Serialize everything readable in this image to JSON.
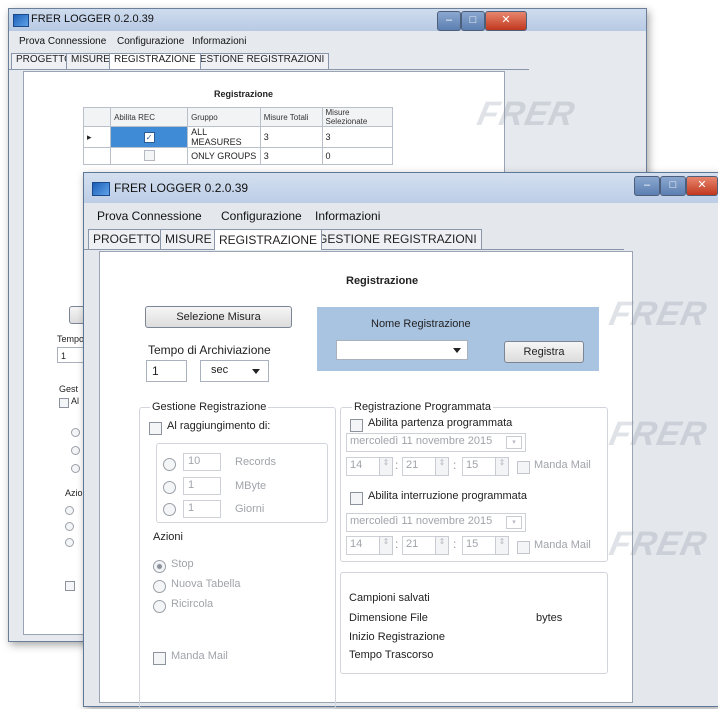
{
  "back_window": {
    "title": "FRER LOGGER 0.2.0.39",
    "menu": [
      "Prova Connessione",
      "Configurazione",
      "Informazioni"
    ],
    "tabs": [
      "PROGETTO",
      "MISURE",
      "REGISTRAZIONE",
      "GESTIONE REGISTRAZIONI"
    ],
    "heading": "Registrazione",
    "table": {
      "headers": [
        "Abilita REC",
        "Gruppo",
        "Misure Totali",
        "Misure Selezionate"
      ],
      "rows": [
        {
          "gruppo": "ALL MEASURES",
          "totali": "3",
          "selezionate": "3"
        },
        {
          "gruppo": "ONLY GROUPS",
          "totali": "3",
          "selezionate": "0"
        }
      ]
    },
    "left_fragments": {
      "button": "Q",
      "tempo": "Tempo",
      "value": "1",
      "gest": "Gest",
      "al": "Al",
      "azioni": "Azio"
    }
  },
  "front_window": {
    "title": "FRER LOGGER  0.2.0.39",
    "menu": [
      "Prova Connessione",
      "Configurazione",
      "Informazioni"
    ],
    "tabs": [
      "PROGETTO",
      "MISURE",
      "REGISTRAZIONE",
      "GESTIONE REGISTRAZIONI"
    ],
    "heading": "Registrazione",
    "selezione_misura": "Selezione Misura",
    "tempo_label": "Tempo di Archiviazione",
    "tempo_value": "1",
    "tempo_unit": "sec",
    "nome_registrazione": "Nome Registrazione",
    "registra": "Registra",
    "gestione": {
      "title": "Gestione Registrazione",
      "checkbox": "Al raggiungimento di:",
      "options": [
        {
          "value": "10",
          "unit": "Records"
        },
        {
          "value": "1",
          "unit": "MByte"
        },
        {
          "value": "1",
          "unit": "Giorni"
        }
      ],
      "azioni_title": "Azioni",
      "azioni": [
        "Stop",
        "Nuova Tabella",
        "Ricircola"
      ],
      "manda_mail": "Manda Mail"
    },
    "programmata": {
      "title": "Registrazione Programmata",
      "partenza": "Abilita partenza programmata",
      "partenza_date": "mercoledì 11 novembre 2015",
      "partenza_h": "14",
      "partenza_m": "21",
      "partenza_s": "15",
      "manda_mail": "Manda Mail",
      "interruzione": "Abilita interruzione programmata",
      "interruzione_date": "mercoledì 11 novembre 2015",
      "interruzione_h": "14",
      "interruzione_m": "21",
      "interruzione_s": "15"
    },
    "info": {
      "campioni": "Campioni salvati",
      "dimensione": "Dimensione File",
      "bytes": "bytes",
      "inizio": "Inizio Registrazione",
      "tempo": "Tempo Trascorso"
    }
  },
  "colors": {
    "accent_panel": "#a9c4e1",
    "titlebar_active": "#cfdcef"
  }
}
